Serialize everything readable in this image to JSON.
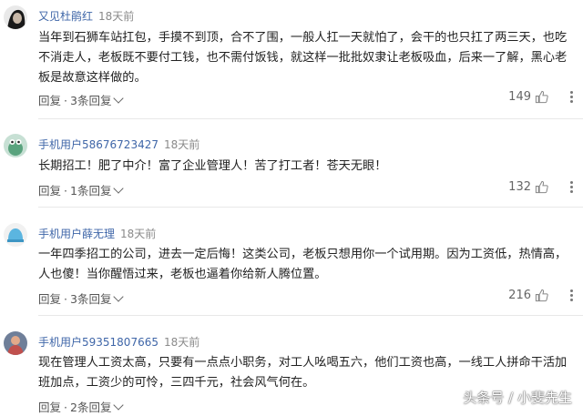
{
  "comments": [
    {
      "username": "又见杜鹃红",
      "time": "18天前",
      "text": "当年到石狮车站扛包，手摸不到顶，合不了围，一般人扛一天就怕了，会干的也只扛了两三天，也吃不消走人，老板既不要付工钱，也不需付饭钱，就这样一批批奴隶让老板吸血，后来一了解，黑心老板是故意这样做的。",
      "reply_label": "回复",
      "dot": "·",
      "replies_label": "3条回复",
      "likes": "149"
    },
    {
      "username": "手机用户58676723427",
      "time": "18天前",
      "text": "长期招工！肥了中介！富了企业管理人！苦了打工者！苍天无眼！",
      "reply_label": "回复",
      "dot": "·",
      "replies_label": "1条回复",
      "likes": "132"
    },
    {
      "username": "手机用户薛无理",
      "time": "18天前",
      "text": "一年四季招工的公司，进去一定后悔！这类公司，老板只想用你一个试用期。因为工资低，热情高，人也傻！当你醒悟过来，老板也逼着你给新人腾位置。",
      "reply_label": "回复",
      "dot": "·",
      "replies_label": "3条回复",
      "likes": "216"
    },
    {
      "username": "手机用户59351807665",
      "time": "18天前",
      "text": "现在管理人工资太高，只要有一点点小职务，对工人吆喝五六，他们工资也高，一线工人拼命干活加班加点，工资少的可怜，三四千元，社会风气何在。",
      "reply_label": "回复",
      "dot": "·",
      "replies_label": "2条回复",
      "likes": ""
    }
  ],
  "watermark": "头条号 / 小斐先生",
  "icons": {
    "like": "thumbs-up-icon",
    "more": "more-vertical-icon",
    "expand": "chevron-down-icon"
  },
  "colors": {
    "username": "#3f66a8",
    "time": "#8a8a8a",
    "text": "#222222",
    "divider": "#e8e8e8"
  }
}
